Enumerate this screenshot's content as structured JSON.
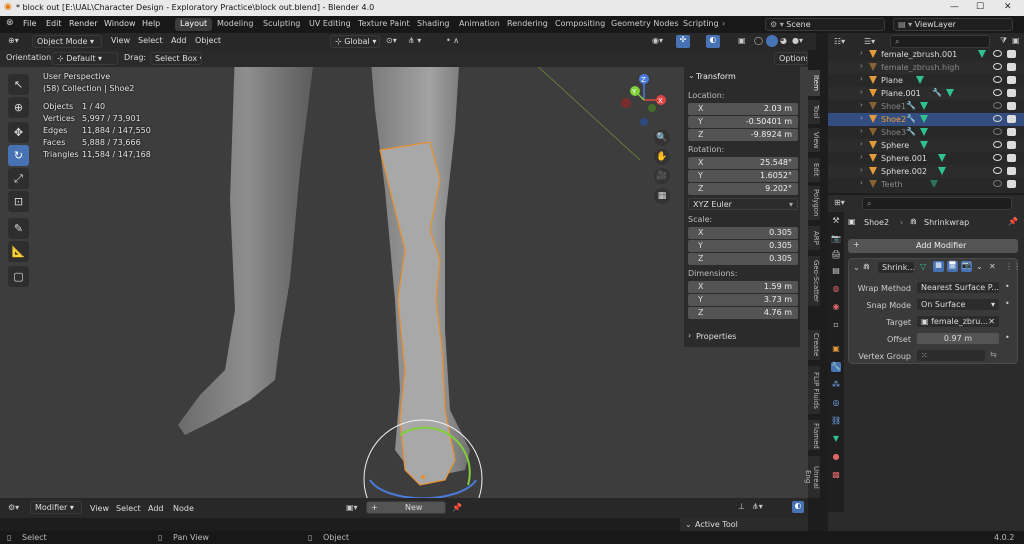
{
  "window": {
    "title": "* block out [E:\\UAL\\Character Design - Exploratory Practice\\block out.blend] - Blender 4.0"
  },
  "menu": [
    "File",
    "Edit",
    "Render",
    "Window",
    "Help"
  ],
  "workspaces": [
    "Layout",
    "Modeling",
    "Sculpting",
    "UV Editing",
    "Texture Paint",
    "Shading",
    "Animation",
    "Rendering",
    "Compositing",
    "Geometry Nodes",
    "Scripting"
  ],
  "scene": "Scene",
  "view_layer": "ViewLayer",
  "viewport_header": {
    "mode": "Object Mode",
    "view": "View",
    "select": "Select",
    "add": "Add",
    "object": "Object",
    "transform_orient": "Global"
  },
  "tool_settings": {
    "orientation_label": "Orientation:",
    "orientation": "Default",
    "drag_label": "Drag:",
    "drag": "Select Box",
    "options": "Options"
  },
  "overlay": {
    "view": "User Perspective",
    "collection": "(58) Collection | Shoe2",
    "stats": [
      {
        "k": "Objects",
        "v": "1 / 40"
      },
      {
        "k": "Vertices",
        "v": "5,997 / 73,901"
      },
      {
        "k": "Edges",
        "v": "11,884 / 147,550"
      },
      {
        "k": "Faces",
        "v": "5,888 / 73,666"
      },
      {
        "k": "Triangles",
        "v": "11,584 / 147,168"
      }
    ]
  },
  "gizmo": {
    "x": "X",
    "y": "Y",
    "z": "Z"
  },
  "transform": {
    "title": "Transform",
    "location_label": "Location:",
    "location": [
      {
        "a": "X",
        "v": "2.03 m"
      },
      {
        "a": "Y",
        "v": "-0.50401 m"
      },
      {
        "a": "Z",
        "v": "-9.8924 m"
      }
    ],
    "rotation_label": "Rotation:",
    "rotation": [
      {
        "a": "X",
        "v": "25.548°"
      },
      {
        "a": "Y",
        "v": "1.6052°"
      },
      {
        "a": "Z",
        "v": "9.202°"
      }
    ],
    "rot_mode": "XYZ Euler",
    "scale_label": "Scale:",
    "scale": [
      {
        "a": "X",
        "v": "0.305"
      },
      {
        "a": "Y",
        "v": "0.305"
      },
      {
        "a": "Z",
        "v": "0.305"
      }
    ],
    "dimensions_label": "Dimensions:",
    "dimensions": [
      {
        "a": "X",
        "v": "1.59 m"
      },
      {
        "a": "Y",
        "v": "3.73 m"
      },
      {
        "a": "Z",
        "v": "4.76 m"
      }
    ],
    "properties": "Properties"
  },
  "side_tabs": [
    "Item",
    "Tool",
    "View",
    "Edit",
    "Polygon",
    "ARP",
    "Geo-Scatter",
    "Create",
    "FLIP Fluids",
    "Flamed",
    "Unreal Eng"
  ],
  "outliner": [
    {
      "name": "female_zbrush.001",
      "dim": false,
      "sel": false
    },
    {
      "name": "female_zbrush.high",
      "dim": true,
      "sel": false
    },
    {
      "name": "Plane",
      "dim": false,
      "sel": false
    },
    {
      "name": "Plane.001",
      "dim": false,
      "sel": false
    },
    {
      "name": "Shoe1",
      "dim": true,
      "sel": false
    },
    {
      "name": "Shoe2",
      "dim": false,
      "sel": true
    },
    {
      "name": "Shoe3",
      "dim": true,
      "sel": false
    },
    {
      "name": "Sphere",
      "dim": false,
      "sel": false
    },
    {
      "name": "Sphere.001",
      "dim": false,
      "sel": false
    },
    {
      "name": "Sphere.002",
      "dim": false,
      "sel": false
    },
    {
      "name": "Teeth",
      "dim": true,
      "sel": false
    }
  ],
  "properties": {
    "object": "Shoe2",
    "modifier_tab": "Shrinkwrap",
    "add_modifier": "Add Modifier",
    "modifier": {
      "name": "Shrink...",
      "wrap_method_label": "Wrap Method",
      "wrap_method": "Nearest Surface P...",
      "snap_mode_label": "Snap Mode",
      "snap_mode": "On Surface",
      "target_label": "Target",
      "target": "female_zbru...",
      "offset_label": "Offset",
      "offset": "0.97 m",
      "vertex_group_label": "Vertex Group"
    }
  },
  "bottom_header": {
    "editor": "Modifier",
    "view": "View",
    "select": "Select",
    "add": "Add",
    "node": "Node",
    "new": "New",
    "active_tool": "Active Tool"
  },
  "status": {
    "select": "Select",
    "pan": "Pan View",
    "object": "Object",
    "version": "4.0.2"
  }
}
